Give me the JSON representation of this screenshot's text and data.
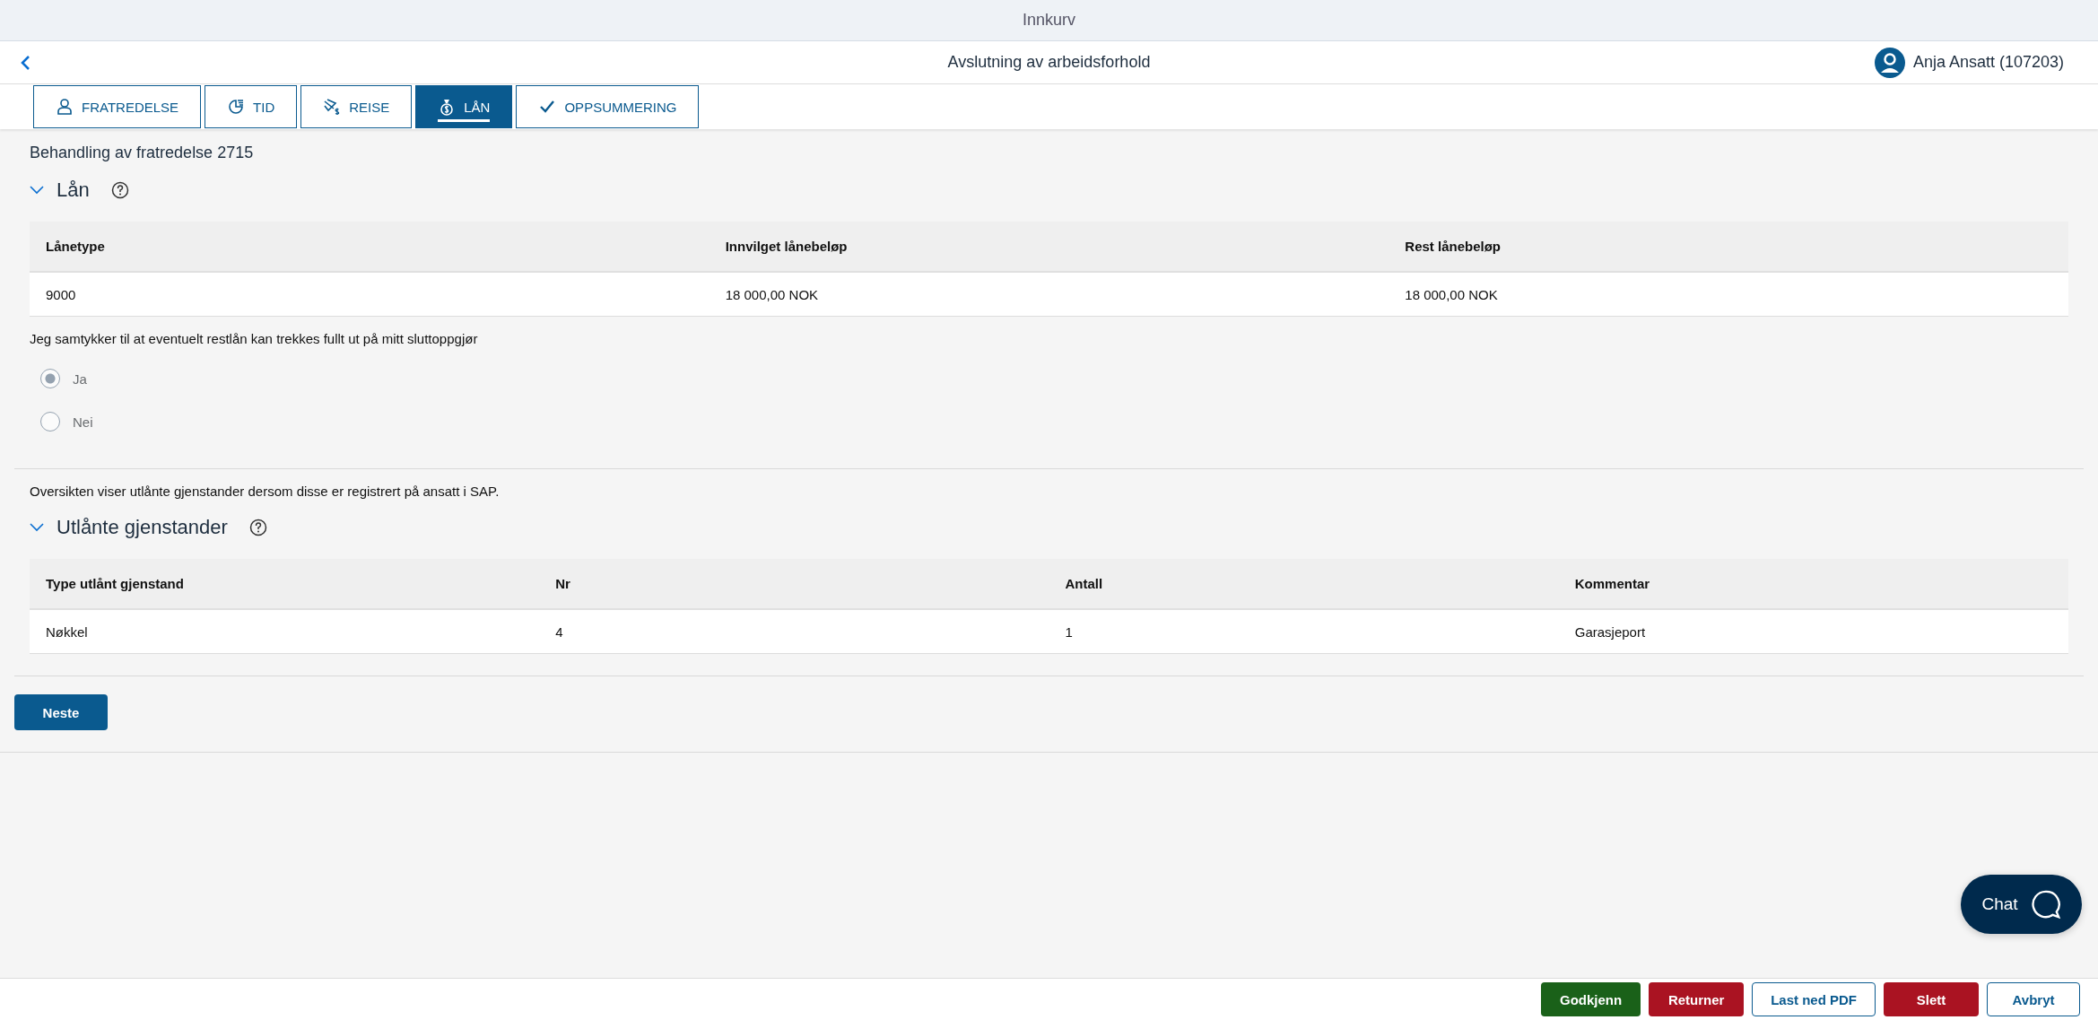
{
  "shell": {
    "title": "Innkurv"
  },
  "header": {
    "title": "Avslutning av arbeidsforhold",
    "user": "Anja Ansatt (107203)"
  },
  "tabs": [
    {
      "label": "FRATREDELSE",
      "selected": false
    },
    {
      "label": "TID",
      "selected": false
    },
    {
      "label": "REISE",
      "selected": false
    },
    {
      "label": "LÅN",
      "selected": true
    },
    {
      "label": "OPPSUMMERING",
      "selected": false
    }
  ],
  "case_title": "Behandling av fratredelse 2715",
  "loan_section": {
    "title": "Lån",
    "expanded": true,
    "table": {
      "columns": [
        "Lånetype",
        "Innvilget lånebeløp",
        "Rest lånebeløp"
      ],
      "rows": [
        [
          "9000",
          "18 000,00 NOK",
          "18 000,00 NOK"
        ]
      ]
    },
    "consent": {
      "question": "Jeg samtykker til at eventuelt restlån kan trekkes fullt ut på mitt sluttoppgjør",
      "disabled": true,
      "options": [
        {
          "label": "Ja",
          "selected": true
        },
        {
          "label": "Nei",
          "selected": false
        }
      ]
    }
  },
  "items_note": "Oversikten viser utlånte gjenstander dersom disse er registrert på ansatt i SAP.",
  "items_section": {
    "title": "Utlånte gjenstander",
    "expanded": true,
    "table": {
      "columns": [
        "Type utlånt gjenstand",
        "Nr",
        "Antall",
        "Kommentar"
      ],
      "rows": [
        [
          "Nøkkel",
          "4",
          "1",
          "Garasjeport"
        ]
      ]
    }
  },
  "next_button": "Neste",
  "chat_button": "Chat",
  "footer_buttons": [
    {
      "label": "Godkjenn",
      "kind": "accept"
    },
    {
      "label": "Returner",
      "kind": "danger"
    },
    {
      "label": "Last ned PDF",
      "kind": "ghost"
    },
    {
      "label": "Slett",
      "kind": "danger"
    },
    {
      "label": "Avbryt",
      "kind": "ghost"
    }
  ]
}
